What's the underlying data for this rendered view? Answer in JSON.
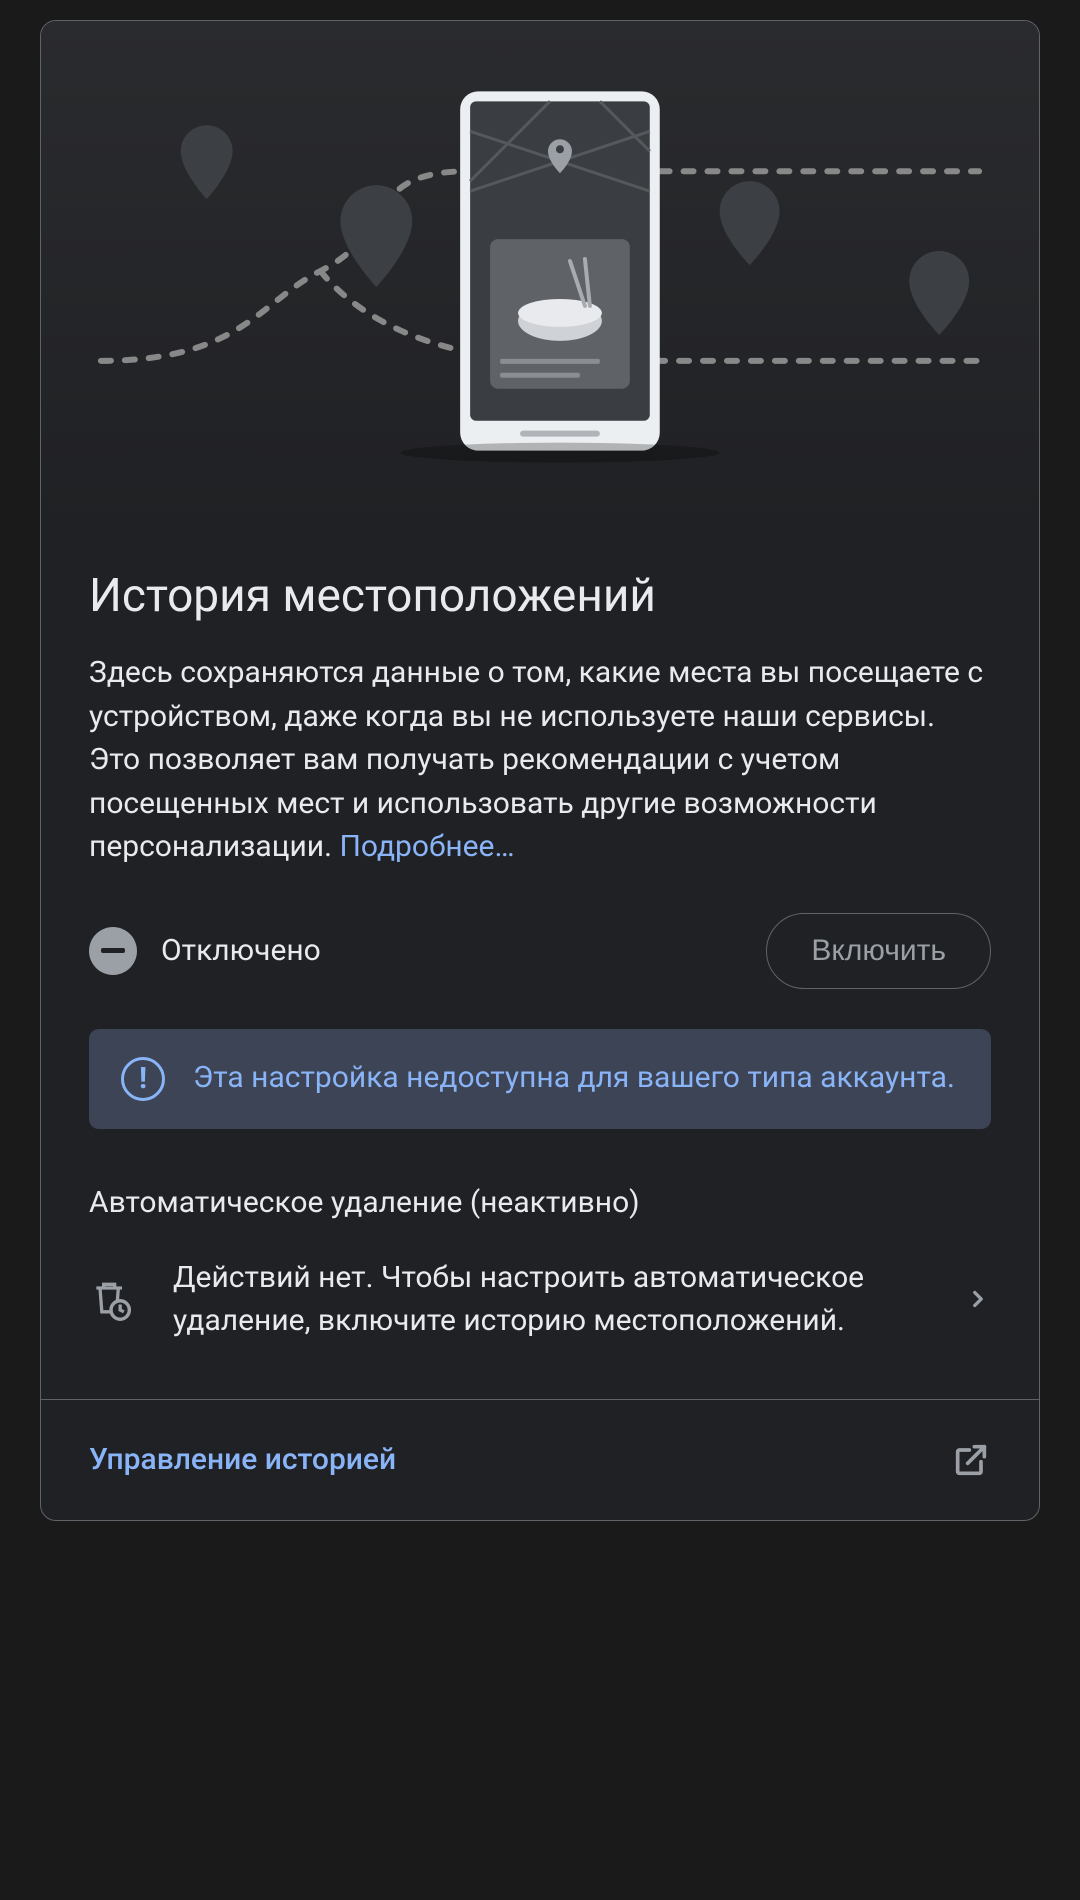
{
  "title": "История местоположений",
  "description": "Здесь сохраняются данные о том, какие места вы посещаете с устройством, даже когда вы не используете наши сервисы. Это позволяет вам получать рекомендации с учетом посещенных мест и использовать другие возможности персонализации. ",
  "learnMore": "Подробнее…",
  "status": {
    "label": "Отключено",
    "enableButton": "Включить"
  },
  "alert": "Эта настройка недоступна для вашего типа аккаунта.",
  "autoDelete": {
    "heading": "Автоматическое удаление (неактивно)",
    "body": "Действий нет. Чтобы настроить автоматическое удаление, включите историю местоположений."
  },
  "footer": {
    "manageHistory": "Управление историей"
  }
}
